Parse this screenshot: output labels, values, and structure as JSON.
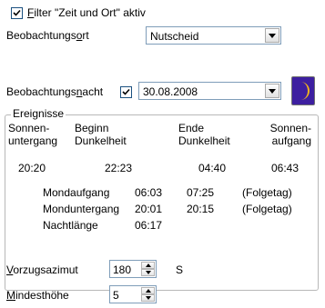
{
  "filter": {
    "label_pre": "",
    "label_mn": "F",
    "label_post": "ilter \"Zeit und Ort\" aktiv",
    "checked": true
  },
  "location": {
    "label_pre": "Beobachtungs",
    "label_mn": "o",
    "label_post": "rt",
    "value": "Nutscheid"
  },
  "night": {
    "label_pre": "Beobachtungs",
    "label_mn": "n",
    "label_post": "acht",
    "checked": true,
    "date": "30.08.2008"
  },
  "events": {
    "legend": "Ereignisse",
    "headers": [
      {
        "line1": "Sonnen-",
        "line2": "untergang"
      },
      {
        "line1": "Beginn",
        "line2": "Dunkelheit"
      },
      {
        "line1": "Ende",
        "line2": "Dunkelheit"
      },
      {
        "line1": "Sonnen-",
        "line2": "aufgang"
      }
    ],
    "times": [
      "20:20",
      "22:23",
      "04:40",
      "06:43"
    ],
    "moon_rows": [
      {
        "label": "Mondaufgang",
        "t1": "06:03",
        "t2": "07:25",
        "note": "(Folgetag)"
      },
      {
        "label": "Monduntergang",
        "t1": "20:01",
        "t2": "20:15",
        "note": "(Folgetag)"
      },
      {
        "label": "Nachtlänge",
        "t1": "06:17",
        "t2": "",
        "note": ""
      }
    ]
  },
  "azimuth": {
    "label_pre": "",
    "label_mn": "V",
    "label_post": "orzugsazimut",
    "value": "180",
    "unit": "S"
  },
  "min_height": {
    "label_pre": "",
    "label_mn": "M",
    "label_post": "indesthöhe",
    "value": "5"
  },
  "colors": {
    "moon_button_bg": "#3d1fa0",
    "moon_color": "#f2b51c",
    "group_border": "#b8b8b8"
  },
  "icons": {
    "moon": "crescent-moon-icon",
    "check": "checkmark-icon",
    "dropdown": "chevron-down-icon"
  }
}
